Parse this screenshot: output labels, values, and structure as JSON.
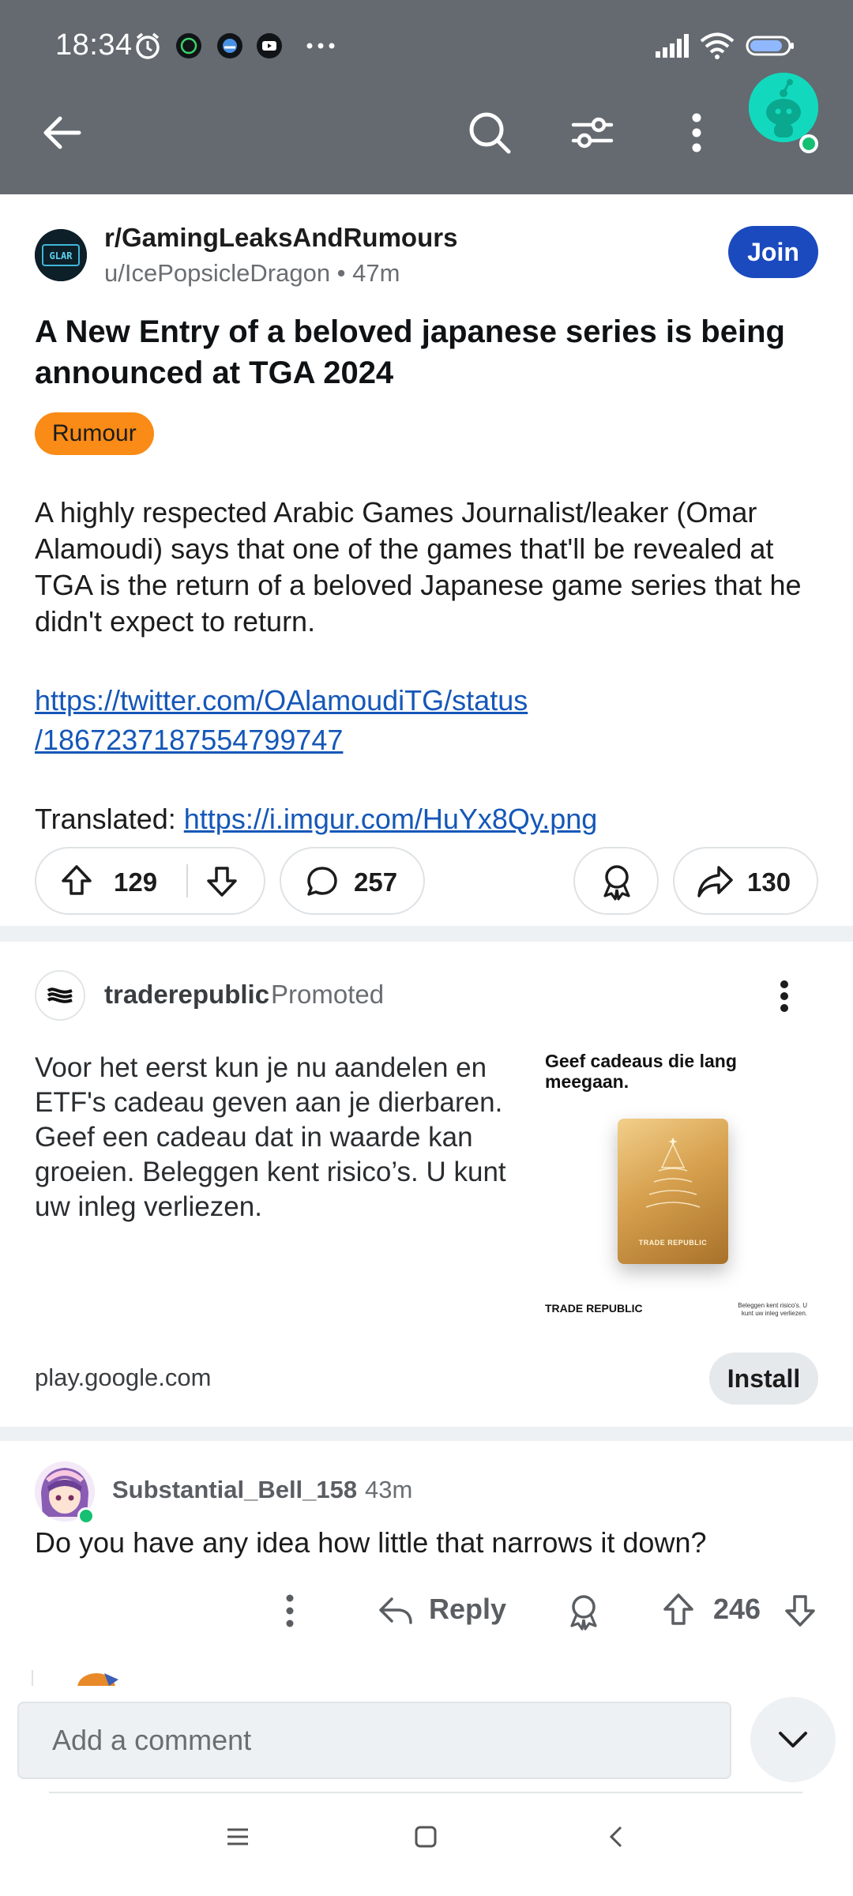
{
  "status_bar": {
    "time": "18:34"
  },
  "app_bar": {
    "back_icon": "arrow-left-icon",
    "search_icon": "search-icon",
    "filter_icon": "sort-filter-icon",
    "more_icon": "more-vertical-icon"
  },
  "post": {
    "subreddit": "r/GamingLeaksAndRumours",
    "author": "u/IcePopsicleDragon",
    "age": "47m",
    "join_label": "Join",
    "title": "A New Entry of a beloved japanese series is being announced at TGA 2024",
    "flair": "Rumour",
    "body": "A highly respected Arabic Games Journalist/leaker (Omar Alamoudi) says that one of the games that'll be revealed at TGA is the return of a beloved Japanese game series that he didn't expect to return.",
    "link_line1": "https://twitter.com/OAlamoudiTG/status",
    "link_line2": "/1867237187554799747",
    "translated_label": "Translated:",
    "translated_link": "https://i.imgur.com/HuYx8Qy.png",
    "upvotes": "129",
    "comments": "257",
    "shares": "130",
    "colors": {
      "join": "#1b4abf",
      "flair": "#f98b16",
      "link": "#1557b8"
    }
  },
  "ad": {
    "advertiser": "traderepublic",
    "promoted_label": "Promoted",
    "text": "Voor het eerst kun je nu aandelen en ETF's cadeau geven aan je dierbaren. Geef een cadeau dat in waarde kan groeien. Beleggen kent risico’s. U kunt uw inleg verliezen.",
    "image_title": "Geef cadeaus die lang meegaan.",
    "image_card_text": "TRADE REPUBLIC",
    "image_brand": "TRADE REPUBLIC",
    "image_risk": "Beleggen kent risico's. U kunt uw inleg verliezen.",
    "domain": "play.google.com",
    "install_label": "Install"
  },
  "comment": {
    "author": "Substantial_Bell_158",
    "age": "43m",
    "body": "Do you have any idea how little that narrows it down?",
    "reply_label": "Reply",
    "score": "246"
  },
  "composer": {
    "placeholder": "Add a comment"
  }
}
